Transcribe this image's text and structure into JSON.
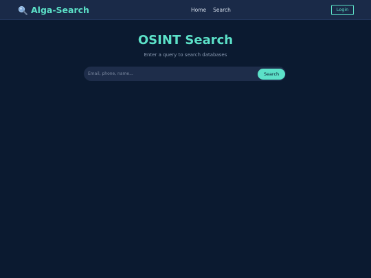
{
  "header": {
    "brand_icon": "magnifier-icon",
    "brand_name": "Alga-Search",
    "nav": [
      "Home",
      "Search"
    ],
    "login_label": "Login"
  },
  "hero": {
    "title": "OSINT Search",
    "subtitle": "Enter a query to search databases"
  },
  "search": {
    "placeholder": "Email, phone, name...",
    "value": "",
    "button_label": "Search"
  },
  "colors": {
    "accent": "#5ce1c8",
    "background": "#0b1a30",
    "navbar": "#1a2a48",
    "input_background": "#1e2d4a"
  }
}
